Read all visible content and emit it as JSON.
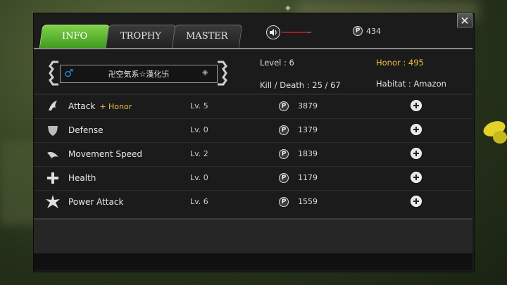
{
  "tabs": [
    {
      "label": "INFO",
      "active": true
    },
    {
      "label": "TROPHY",
      "active": false
    },
    {
      "label": "MASTER",
      "active": false
    }
  ],
  "header": {
    "points": "434",
    "close_glyph": "✕",
    "top_marker": "◈",
    "sound_level": 0.85
  },
  "profile": {
    "gender_icon": "male-symbol",
    "gender_glyph": "♂",
    "name": "卍空気系☆漢化卐",
    "name_marker": "◈",
    "level": "Level : 6",
    "kill_death": "Kill / Death : 25 / 67",
    "honor": "Honor : 495",
    "habitat": "Habitat : Amazon"
  },
  "skills": [
    {
      "name": "Attack",
      "bonus": "+ Honor",
      "level": "Lv. 5",
      "cost": "3879",
      "icon": "claw-icon"
    },
    {
      "name": "Defense",
      "bonus": "",
      "level": "Lv. 0",
      "cost": "1379",
      "icon": "shield-icon"
    },
    {
      "name": "Movement Speed",
      "bonus": "",
      "level": "Lv. 2",
      "cost": "1839",
      "icon": "wing-icon"
    },
    {
      "name": "Health",
      "bonus": "",
      "level": "Lv. 0",
      "cost": "1179",
      "icon": "cross-icon"
    },
    {
      "name": "Power Attack",
      "bonus": "",
      "level": "Lv. 6",
      "cost": "1559",
      "icon": "burst-icon"
    }
  ],
  "point_glyph": "P",
  "colors": {
    "active_tab": "#5cb82e",
    "honor_gold": "#f0c040",
    "gender_blue": "#2a8ad8"
  }
}
